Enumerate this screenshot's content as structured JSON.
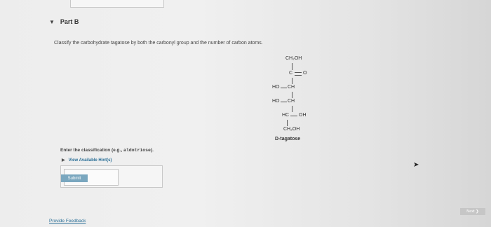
{
  "part": {
    "title": "Part B",
    "caret": "▼"
  },
  "question": {
    "prompt": "Classify the carbohydrate tagatose by both the carbonyl group and the number of carbon atoms."
  },
  "structure": {
    "rows": [
      "CH₂OH",
      "C",
      "O",
      "HO",
      "CH",
      "HO",
      "CH",
      "HC",
      "OH",
      "CH₂OH"
    ],
    "name": "D-tagatose"
  },
  "answer": {
    "label_prefix": "Enter the classification (e.g., ",
    "label_example": "aldotriose",
    "label_suffix": ").",
    "hints_arrow": "▶",
    "hints_label": "View Available Hint(s)",
    "input_value": ""
  },
  "buttons": {
    "submit": "Submit",
    "next": "Next ❯"
  },
  "links": {
    "feedback": "Provide Feedback"
  },
  "icons": {
    "cursor": "mouse-cursor-icon"
  }
}
